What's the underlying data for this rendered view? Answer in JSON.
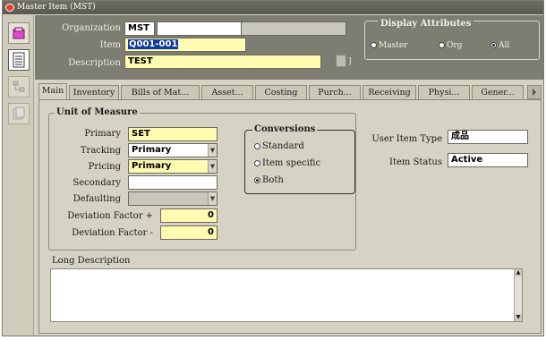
{
  "window": {
    "title": "Master Item (MST)"
  },
  "header": {
    "organization_label": "Organization",
    "organization_value": "MST",
    "item_label": "Item",
    "item_value": "Q001-001",
    "description_label": "Description",
    "description_value": "TEST"
  },
  "display_attributes": {
    "title": "Display Attributes",
    "options": [
      "Master",
      "Org",
      "All"
    ],
    "selected": "All"
  },
  "tabs": [
    "Main",
    "Inventory",
    "Bills of Mat...",
    "Asset...",
    "Costing",
    "Purch...",
    "Receiving",
    "Physi...",
    "Gener..."
  ],
  "active_tab": "Main",
  "uom": {
    "title": "Unit of Measure",
    "primary_label": "Primary",
    "primary_value": "SET",
    "tracking_label": "Tracking",
    "tracking_value": "Primary",
    "pricing_label": "Pricing",
    "pricing_value": "Primary",
    "secondary_label": "Secondary",
    "secondary_value": "",
    "defaulting_label": "Defaulting",
    "defaulting_value": "",
    "dev_plus_label": "Deviation Factor +",
    "dev_plus_value": "0",
    "dev_minus_label": "Deviation Factor -",
    "dev_minus_value": "0"
  },
  "conversions": {
    "title": "Conversions",
    "options": [
      "Standard",
      "Item specific",
      "Both"
    ],
    "selected": "Both"
  },
  "right_fields": {
    "user_item_type_label": "User Item Type",
    "user_item_type_value": "成品",
    "item_status_label": "Item Status",
    "item_status_value": "Active"
  },
  "long_description": {
    "label": "Long Description",
    "value": ""
  },
  "colors": {
    "header_bg": "#7e7d71",
    "required_field": "#fffbb1",
    "selection": "#103a9c",
    "titlebar": "#5a594f"
  },
  "icons": [
    "app-icon",
    "navigator-icon",
    "form-list-icon",
    "tree-icon",
    "folder-icon"
  ]
}
